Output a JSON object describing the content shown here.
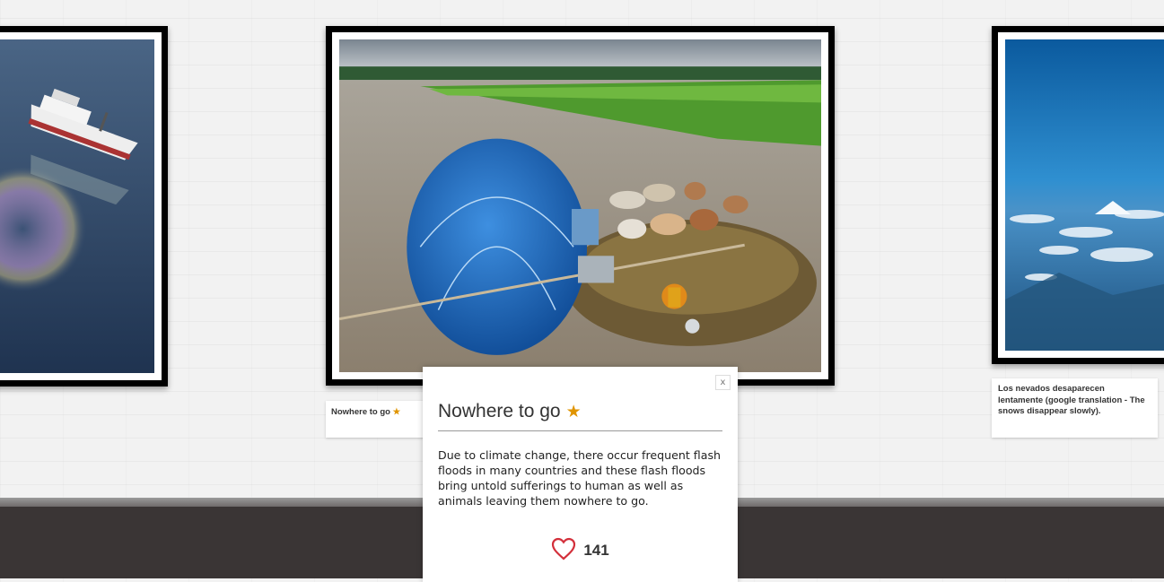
{
  "gallery": {
    "artworks": [
      {
        "image_desc": "white boat on dark blue water with oil rainbow sheen"
      },
      {
        "image_desc": "flooded field, blue tarp haystack, cattle on small island, woman in orange sari"
      },
      {
        "image_desc": "aerial view of blue sky, clouds and snowy mountains"
      }
    ],
    "center_label": {
      "title": "Nowhere to go",
      "star": "★"
    },
    "right_label": {
      "text": "Los nevados desaparecen lentamente (google translation - The snows disappear slowly)."
    }
  },
  "modal": {
    "close_label": "x",
    "title": "Nowhere to go",
    "star": "★",
    "description": "Due to climate change, there occur frequent flash floods in many countries and these flash floods bring untold sufferings to human as well as animals leaving them nowhere to go.",
    "like_count": "141"
  },
  "colors": {
    "star": "#e09400",
    "heart": "#d32f3a",
    "floor": "#3a3535"
  }
}
